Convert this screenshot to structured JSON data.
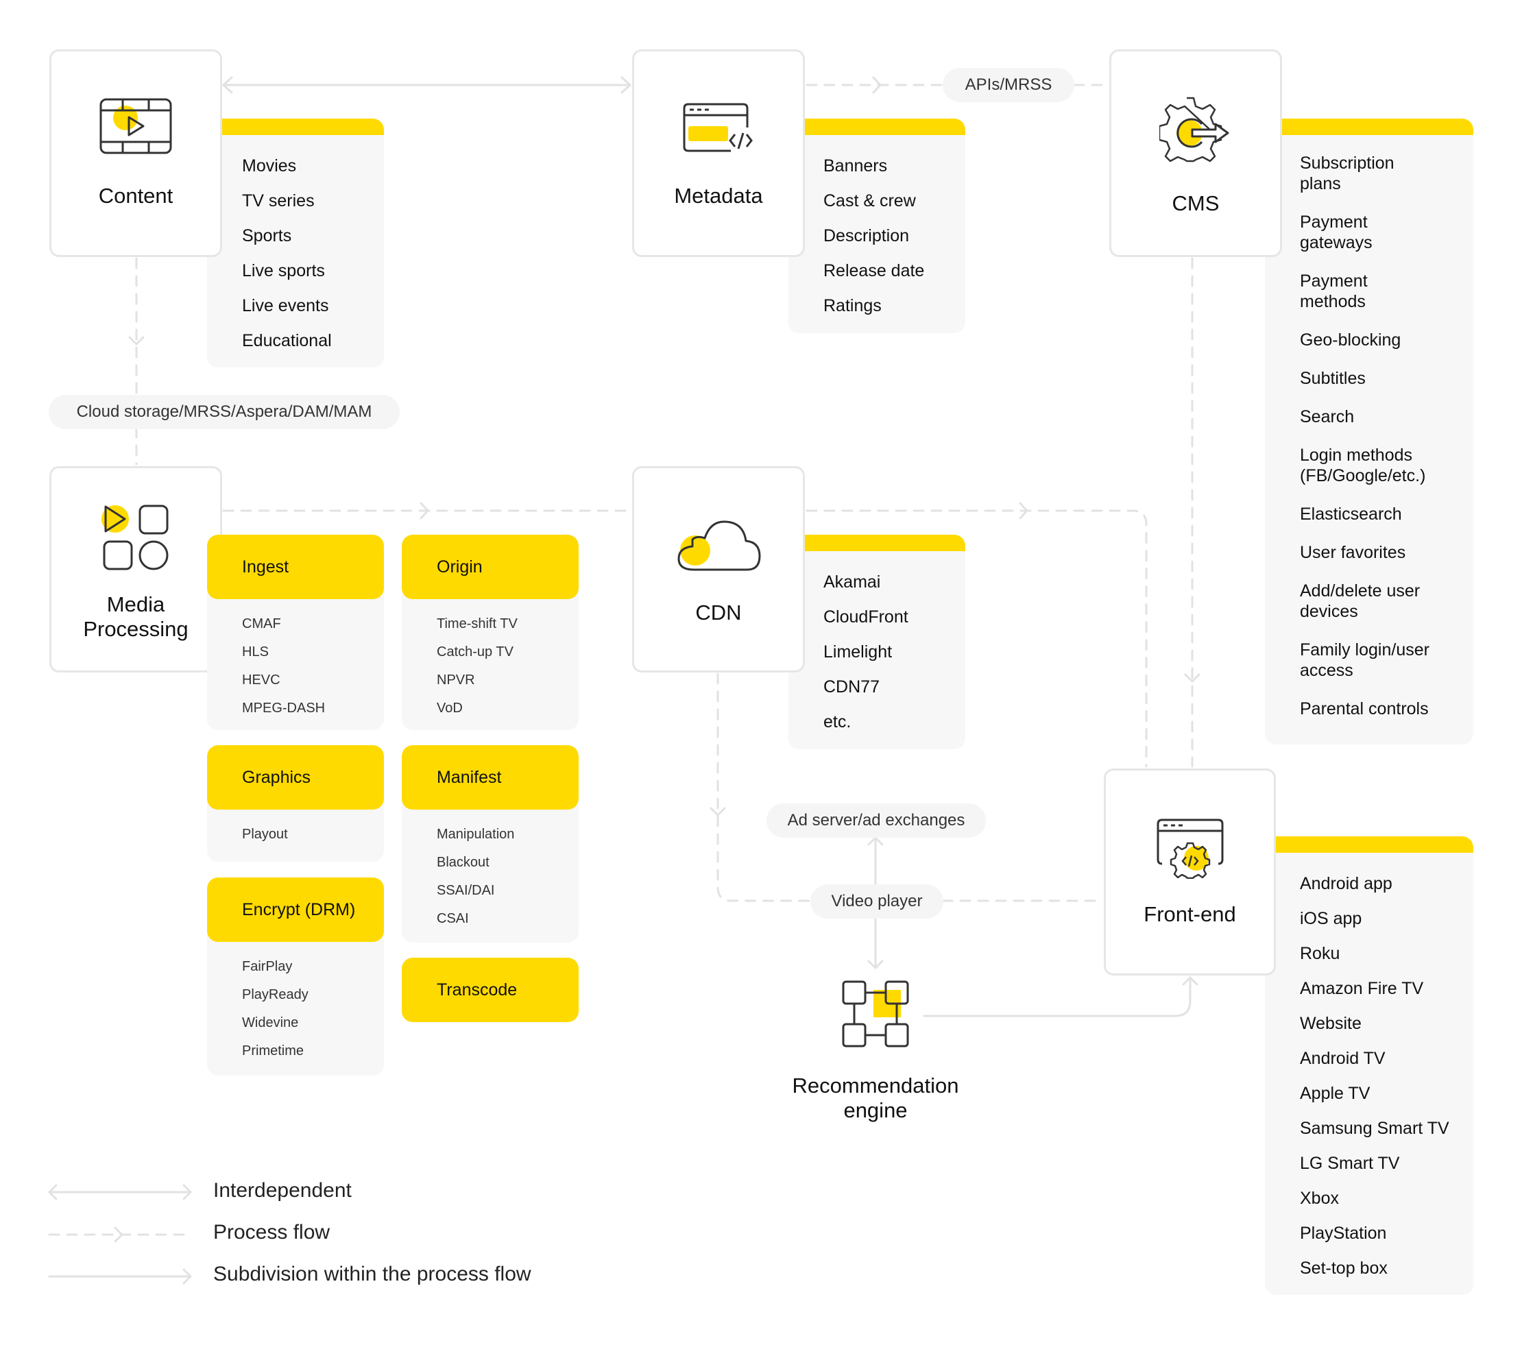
{
  "colors": {
    "accent": "#ffda00",
    "panel": "#f7f7f7",
    "border": "#e6e6e6",
    "line": "#dddddd",
    "text": "#111111"
  },
  "nodes": {
    "content": {
      "title": "Content",
      "icon": "film-play-icon",
      "items": [
        "Movies",
        "TV series",
        "Sports",
        "Live sports",
        "Live events",
        "Educational"
      ]
    },
    "metadata": {
      "title": "Metadata",
      "icon": "browser-code-icon",
      "items": [
        "Banners",
        "Cast & crew",
        "Description",
        "Release date",
        "Ratings"
      ]
    },
    "cms": {
      "title": "CMS",
      "icon": "gear-arrow-icon",
      "items": [
        "Subscription plans",
        "Payment gateways",
        "Payment methods",
        "Geo-blocking",
        "Subtitles",
        "Search",
        "Login methods (FB/Google/etc.)",
        "Elasticsearch",
        "User favorites",
        "Add/delete user devices",
        "Family login/user access",
        "Parental controls"
      ]
    },
    "media_processing": {
      "title_line1": "Media",
      "title_line2": "Processing",
      "icon": "media-shapes-icon"
    },
    "cdn": {
      "title": "CDN",
      "icon": "cloud-icon",
      "items": [
        "Akamai",
        "CloudFront",
        "Limelight",
        "CDN77",
        "etc."
      ]
    },
    "front_end": {
      "title": "Front-end",
      "icon": "browser-gear-icon",
      "items": [
        "Android app",
        "iOS app",
        "Roku",
        "Amazon Fire TV",
        "Website",
        "Android TV",
        "Apple TV",
        "Samsung Smart TV",
        "LG Smart TV",
        "Xbox",
        "PlayStation",
        "Set-top box"
      ]
    },
    "recommendation": {
      "title_line1": "Recommendation",
      "title_line2": "engine",
      "icon": "network-blocks-icon"
    }
  },
  "processing_cards": {
    "ingest": {
      "title": "Ingest",
      "items": [
        "CMAF",
        "HLS",
        "HEVC",
        "MPEG-DASH"
      ]
    },
    "origin": {
      "title": "Origin",
      "items": [
        "Time-shift TV",
        "Catch-up TV",
        "NPVR",
        "VoD"
      ]
    },
    "graphics": {
      "title": "Graphics",
      "items": [
        "Playout"
      ]
    },
    "manifest": {
      "title": "Manifest",
      "items": [
        "Manipulation",
        "Blackout",
        "SSAI/DAI",
        "CSAI"
      ]
    },
    "encrypt": {
      "title": "Encrypt (DRM)",
      "items": [
        "FairPlay",
        "PlayReady",
        "Widevine",
        "Primetime"
      ]
    },
    "transcode": {
      "title": "Transcode"
    }
  },
  "connectors": {
    "apis_mrss": "APIs/MRSS",
    "cloud_storage": "Cloud storage/MRSS/Aspera/DAM/MAM",
    "ad_server": "Ad server/ad exchanges",
    "video_player": "Video player"
  },
  "legend": [
    {
      "label": "Interdependent",
      "style": "solid-double-arrow"
    },
    {
      "label": "Process flow",
      "style": "dashed-arrow"
    },
    {
      "label": "Subdivision within the process flow",
      "style": "solid-arrow"
    }
  ]
}
